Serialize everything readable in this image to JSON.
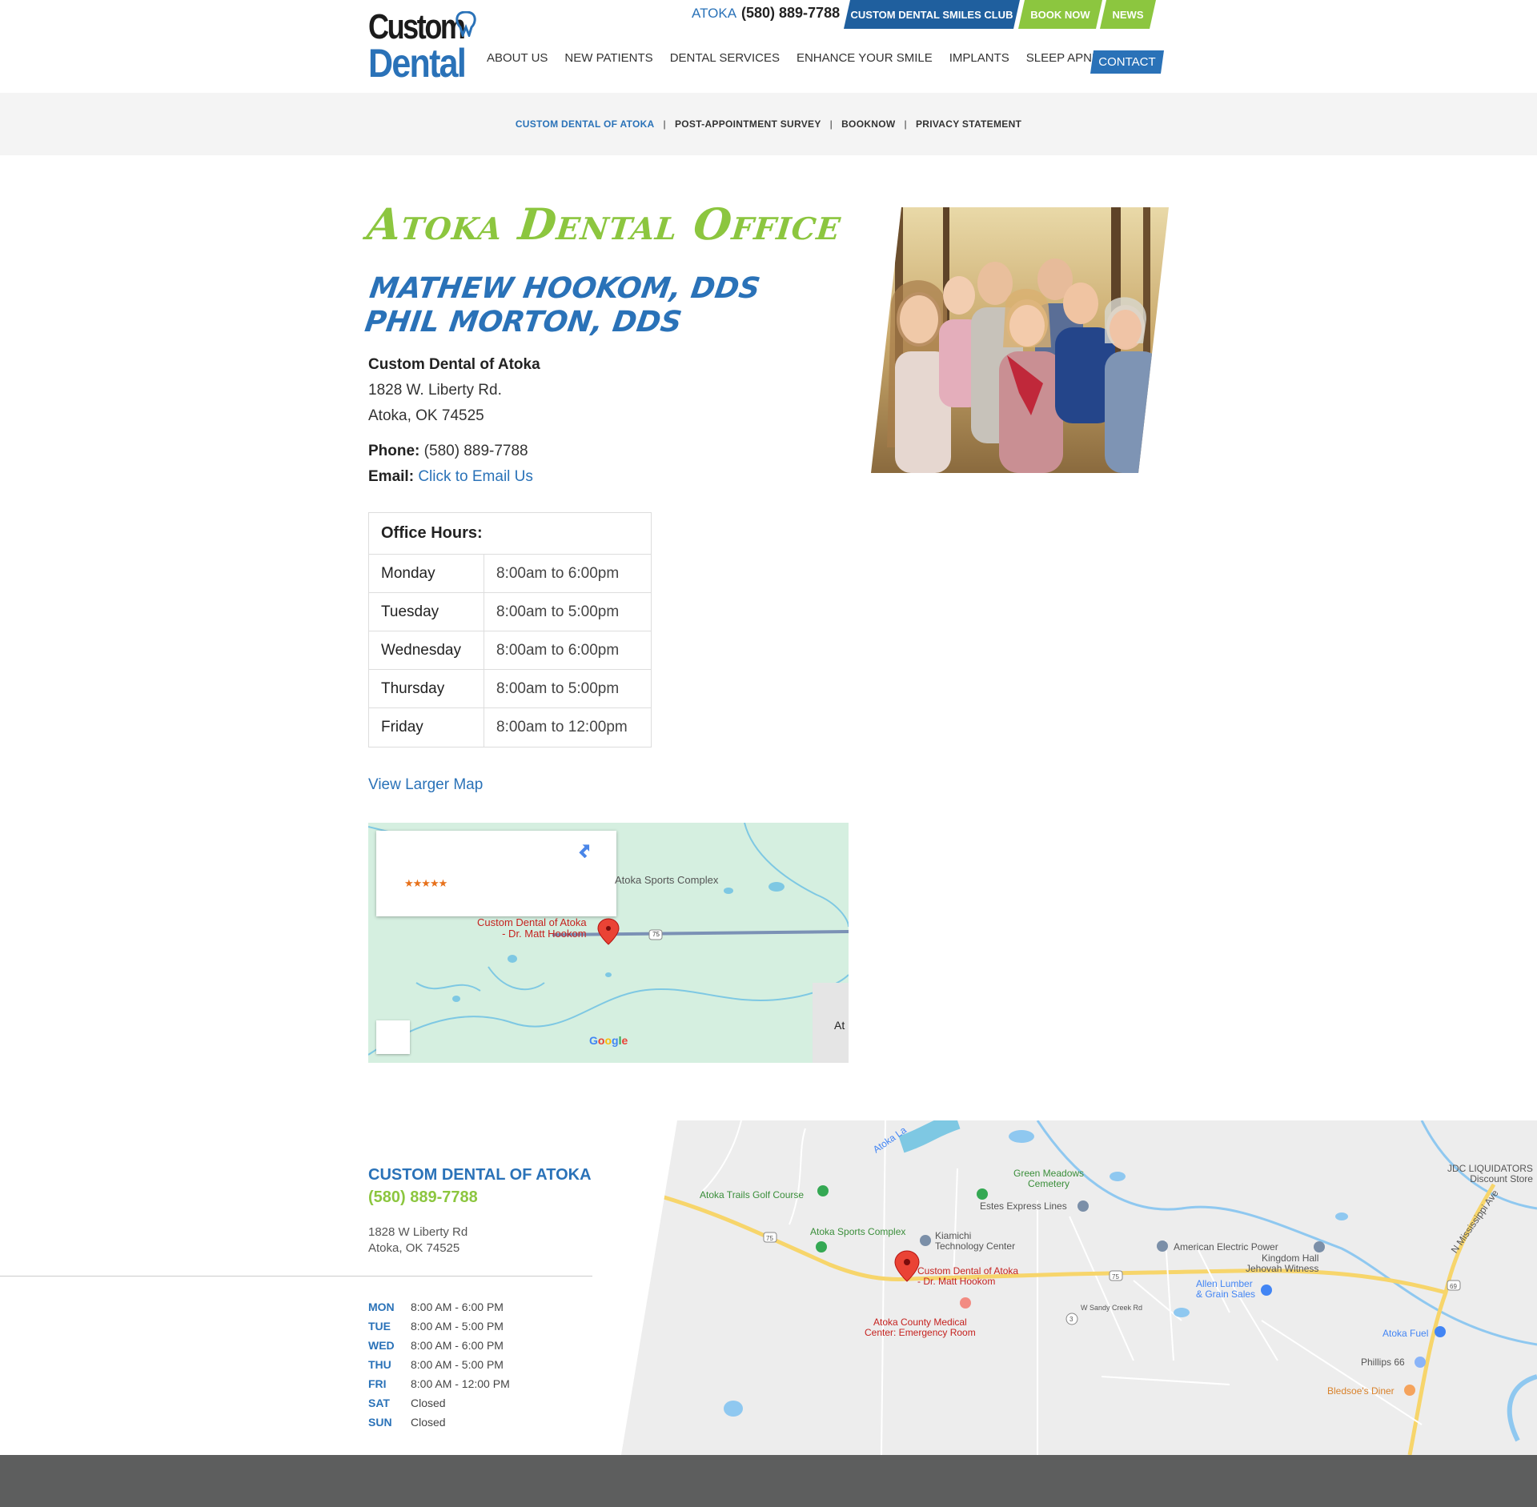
{
  "header": {
    "logo_line1": "Custom",
    "logo_line2": "Dental",
    "location": "ATOKA",
    "phone": "(580) 889-7788",
    "top_buttons": {
      "club": "CUSTOM DENTAL SMILES CLUB",
      "book": "BOOK NOW",
      "news": "NEWS"
    },
    "nav": [
      "ABOUT US",
      "NEW PATIENTS",
      "DENTAL SERVICES",
      "ENHANCE YOUR SMILE",
      "IMPLANTS",
      "SLEEP APNEA"
    ],
    "contact": "CONTACT"
  },
  "subnav": [
    "CUSTOM DENTAL OF ATOKA",
    "POST-APPOINTMENT SURVEY",
    "BOOKNOW",
    "PRIVACY STATEMENT"
  ],
  "subnav_sep": "|",
  "main": {
    "title": "Atoka Dental Office",
    "doctors": [
      "MATHEW HOOKOM, DDS",
      "PHIL MORTON, DDS"
    ],
    "office_name": "Custom Dental of Atoka",
    "street": "1828 W. Liberty Rd.",
    "city": "Atoka, OK 74525",
    "phone_label": "Phone:",
    "phone": "(580) 889-7788",
    "email_label": "Email:",
    "email_link": "Click to Email Us"
  },
  "hours_table": {
    "title": "Office Hours:",
    "rows": [
      {
        "day": "Monday",
        "time": "8:00am to 6:00pm"
      },
      {
        "day": "Tuesday",
        "time": "8:00am to 5:00pm"
      },
      {
        "day": "Wednesday",
        "time": "8:00am to 6:00pm"
      },
      {
        "day": "Thursday",
        "time": "8:00am to 5:00pm"
      },
      {
        "day": "Friday",
        "time": "8:00am to 12:00pm"
      }
    ]
  },
  "map_link": "View Larger Map",
  "small_map": {
    "stars": "★★★★★",
    "labels": {
      "sports": "Atoka Sports Complex",
      "pin_line1": "Custom Dental of Atoka",
      "pin_line2": "- Dr. Matt Hookom",
      "route": "75",
      "town": "At"
    },
    "google": "Google"
  },
  "footer": {
    "title": "CUSTOM DENTAL OF ATOKA",
    "phone": "(580) 889-7788",
    "street": "1828 W Liberty Rd",
    "city": "Atoka, OK 74525",
    "hours": [
      {
        "day": "MON",
        "time": "8:00 AM - 6:00 PM"
      },
      {
        "day": "TUE",
        "time": "8:00 AM - 5:00 PM"
      },
      {
        "day": "WED",
        "time": "8:00 AM - 6:00 PM"
      },
      {
        "day": "THU",
        "time": "8:00 AM - 5:00 PM"
      },
      {
        "day": "FRI",
        "time": "8:00 AM - 12:00 PM"
      },
      {
        "day": "SAT",
        "time": "Closed"
      },
      {
        "day": "SUN",
        "time": "Closed"
      }
    ]
  },
  "big_map": {
    "labels": {
      "lake": "Atoka La",
      "green_meadows": "Green Meadows\nCemetery",
      "golf": "Atoka Trails Golf Course",
      "estes": "Estes Express Lines",
      "sports": "Atoka Sports Complex",
      "kiamichi": "Kiamichi\nTechnology Center",
      "aep": "American Electric Power",
      "kingdom": "Kingdom Hall\nJehovah Witness",
      "pin": "Custom Dental of Atoka\n- Dr. Matt Hookom",
      "allen": "Allen Lumber\n& Grain Sales",
      "medical": "Atoka County Medical\nCenter: Emergency Room",
      "fuel": "Atoka Fuel",
      "phillips": "Phillips 66",
      "bledsoe": "Bledsoe's Diner",
      "jdc": "JDC LIQUIDATORS\nDiscount Store",
      "miss": "N Mississippi Ave",
      "sandy": "W Sandy Creek Rd",
      "r75a": "75",
      "r75b": "75",
      "r69": "69",
      "r3": "3"
    }
  },
  "colors": {
    "blue": "#2a72b8",
    "green": "#8cc63f",
    "dark_blue": "#1f5f9e",
    "footer_bar": "#5d5e5e"
  }
}
